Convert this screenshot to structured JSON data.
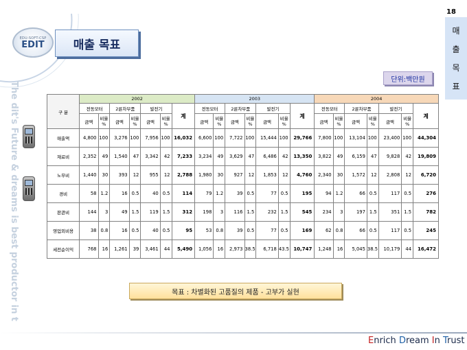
{
  "header": {
    "page_number": "18",
    "logo_small": "EDU-SOFT-CSP",
    "logo_big": "EDIT",
    "title": "매출 목표",
    "vertical_tab": [
      "매",
      "출",
      "목",
      "표"
    ],
    "unit": "단위:백만원"
  },
  "sidebar": {
    "slogan": "The  dit's Future & dreams is best productor in the world"
  },
  "table": {
    "row_header": "구 분",
    "years": [
      "2002",
      "2003",
      "2004"
    ],
    "groups": [
      "전동모터",
      "2륜차부품",
      "발전기"
    ],
    "total_label": "계",
    "sub_amount": "금액",
    "sub_ratio": "비율 %",
    "rows": [
      {
        "label": "매출액",
        "y2002": [
          "4,800",
          "100",
          "3,276",
          "100",
          "7,956",
          "100",
          "16,032"
        ],
        "y2003": [
          "6,600",
          "100",
          "7,722",
          "100",
          "15,444",
          "100",
          "29,766"
        ],
        "y2004": [
          "7,800",
          "100",
          "13,104",
          "100",
          "23,400",
          "100",
          "44,304"
        ]
      },
      {
        "label": "재료비",
        "y2002": [
          "2,352",
          "49",
          "1,540",
          "47",
          "3,342",
          "42",
          "7,233"
        ],
        "y2003": [
          "3,234",
          "49",
          "3,629",
          "47",
          "6,486",
          "42",
          "13,350"
        ],
        "y2004": [
          "3,822",
          "49",
          "6,159",
          "47",
          "9,828",
          "42",
          "19,809"
        ]
      },
      {
        "label": "노무비",
        "y2002": [
          "1,440",
          "30",
          "393",
          "12",
          "955",
          "12",
          "2,788"
        ],
        "y2003": [
          "1,980",
          "30",
          "927",
          "12",
          "1,853",
          "12",
          "4,760"
        ],
        "y2004": [
          "2,340",
          "30",
          "1,572",
          "12",
          "2,808",
          "12",
          "6,720"
        ]
      },
      {
        "label": "경비",
        "y2002": [
          "58",
          "1.2",
          "16",
          "0.5",
          "40",
          "0.5",
          "114"
        ],
        "y2003": [
          "79",
          "1.2",
          "39",
          "0.5",
          "77",
          "0.5",
          "195"
        ],
        "y2004": [
          "94",
          "1.2",
          "66",
          "0.5",
          "117",
          "0.5",
          "276"
        ]
      },
      {
        "label": "판관비",
        "y2002": [
          "144",
          "3",
          "49",
          "1.5",
          "119",
          "1.5",
          "312"
        ],
        "y2003": [
          "198",
          "3",
          "116",
          "1.5",
          "232",
          "1.5",
          "545"
        ],
        "y2004": [
          "234",
          "3",
          "197",
          "1.5",
          "351",
          "1.5",
          "782"
        ]
      },
      {
        "label": "영업외비용",
        "y2002": [
          "38",
          "0.8",
          "16",
          "0.5",
          "40",
          "0.5",
          "95"
        ],
        "y2003": [
          "53",
          "0.8",
          "39",
          "0.5",
          "77",
          "0.5",
          "169"
        ],
        "y2004": [
          "62",
          "0.8",
          "66",
          "0.5",
          "117",
          "0.5",
          "245"
        ]
      },
      {
        "label": "세전순이익",
        "y2002": [
          "768",
          "16",
          "1,261",
          "39",
          "3,461",
          "44",
          "5,490"
        ],
        "y2003": [
          "1,056",
          "16",
          "2,973",
          "38.5",
          "6,718",
          "43.5",
          "10,747"
        ],
        "y2004": [
          "1,248",
          "16",
          "5,045",
          "38.5",
          "10,179",
          "44",
          "16,472"
        ]
      }
    ]
  },
  "goal": "목표 : 차별화된 고품질의 제품 - 고부가 실현",
  "footer": {
    "e": "E",
    "rest1": "nrich ",
    "d": "D",
    "rest2": "ream ",
    "i": "I",
    "rest3": "n ",
    "t": "T",
    "rest4": "rust"
  },
  "colors": {
    "y2002": "#dcebc6",
    "y2003": "#d6e4f3",
    "y2004": "#f7d8b8",
    "vertical_tab": "#d6e4f6"
  }
}
